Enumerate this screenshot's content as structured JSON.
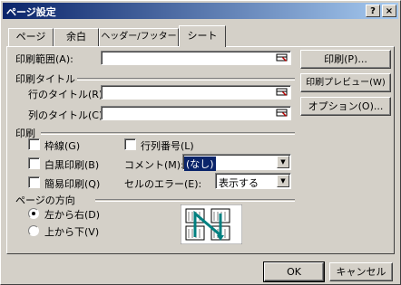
{
  "title": "ページ設定",
  "title_buttons": {
    "help": "?",
    "close": "×"
  },
  "tabs": [
    {
      "label": "ページ",
      "active": false
    },
    {
      "label": "余白",
      "active": false
    },
    {
      "label": "ヘッダー/フッター",
      "active": false
    },
    {
      "label": "シート",
      "active": true
    }
  ],
  "print_area": {
    "label": "印刷範囲(A):",
    "value": ""
  },
  "print_titles": {
    "group_label": "印刷タイトル",
    "row_label": "行のタイトル(R):",
    "col_label": "列のタイトル(C):",
    "row_value": "",
    "col_value": ""
  },
  "print": {
    "group_label": "印刷",
    "gridlines": {
      "label": "枠線(G)",
      "checked": false
    },
    "black_white": {
      "label": "白黒印刷(B)",
      "checked": false
    },
    "draft": {
      "label": "簡易印刷(Q)",
      "checked": false
    },
    "row_col_headers": {
      "label": "行列番号(L)",
      "checked": false
    },
    "comments": {
      "label": "コメント(M):",
      "value": "(なし)"
    },
    "cell_errors": {
      "label": "セルのエラー(E):",
      "value": "表示する"
    }
  },
  "page_order": {
    "group_label": "ページの方向",
    "left_to_right": {
      "label": "左から右(D)",
      "selected": true
    },
    "top_to_bottom": {
      "label": "上から下(V)",
      "selected": false
    }
  },
  "side_buttons": {
    "print": "印刷(P)...",
    "print_preview": "印刷プレビュー(W)",
    "options": "オプション(O)..."
  },
  "footer": {
    "ok": "OK",
    "cancel": "キャンセル"
  },
  "icons": {
    "range_picker": "range-picker-icon",
    "order_preview": "page-order-preview-icon"
  }
}
